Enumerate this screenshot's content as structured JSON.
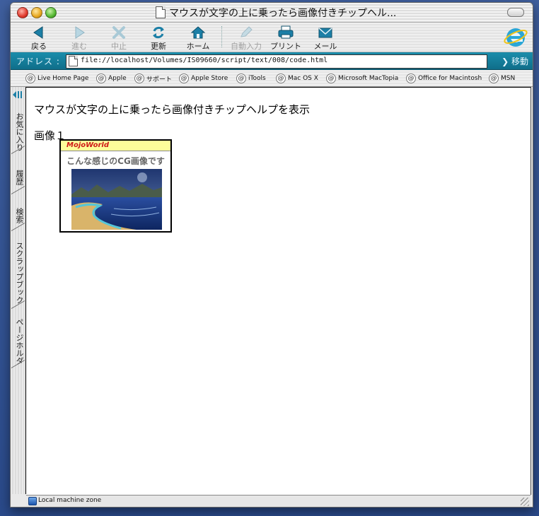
{
  "window": {
    "title": "マウスが文字の上に乗ったら画像付きチップヘル..."
  },
  "toolbar": {
    "back_label": "戻る",
    "forward_label": "進む",
    "stop_label": "中止",
    "refresh_label": "更新",
    "home_label": "ホーム",
    "autofill_label": "自動入力",
    "print_label": "プリント",
    "mail_label": "メール"
  },
  "address": {
    "label": "アドレス :",
    "url": "file://localhost/Volumes/IS09660/script/text/008/code.html",
    "go_label": "移動"
  },
  "favorites": [
    {
      "label": "Live Home Page"
    },
    {
      "label": "Apple"
    },
    {
      "label": "サポート"
    },
    {
      "label": "Apple Store"
    },
    {
      "label": "iTools"
    },
    {
      "label": "Mac OS X"
    },
    {
      "label": "Microsoft MacTopia"
    },
    {
      "label": "Office for Macintosh"
    },
    {
      "label": "MSN"
    }
  ],
  "sidebar_tabs": [
    {
      "label": "お気に入り"
    },
    {
      "label": "履歴"
    },
    {
      "label": "検索"
    },
    {
      "label": "スクラップブック"
    },
    {
      "label": "ページホルダ"
    }
  ],
  "page": {
    "heading": "マウスが文字の上に乗ったら画像付きチップヘルプを表示",
    "image_label": "画像１"
  },
  "tooltip": {
    "brand": "MojoWorld",
    "caption": "こんな感じのCG画像です"
  },
  "status": {
    "zone": "Local machine zone"
  },
  "colors": {
    "accent": "#0f6e8a",
    "tooltip_header": "#fdfd9a",
    "brand_red": "#d01818"
  }
}
